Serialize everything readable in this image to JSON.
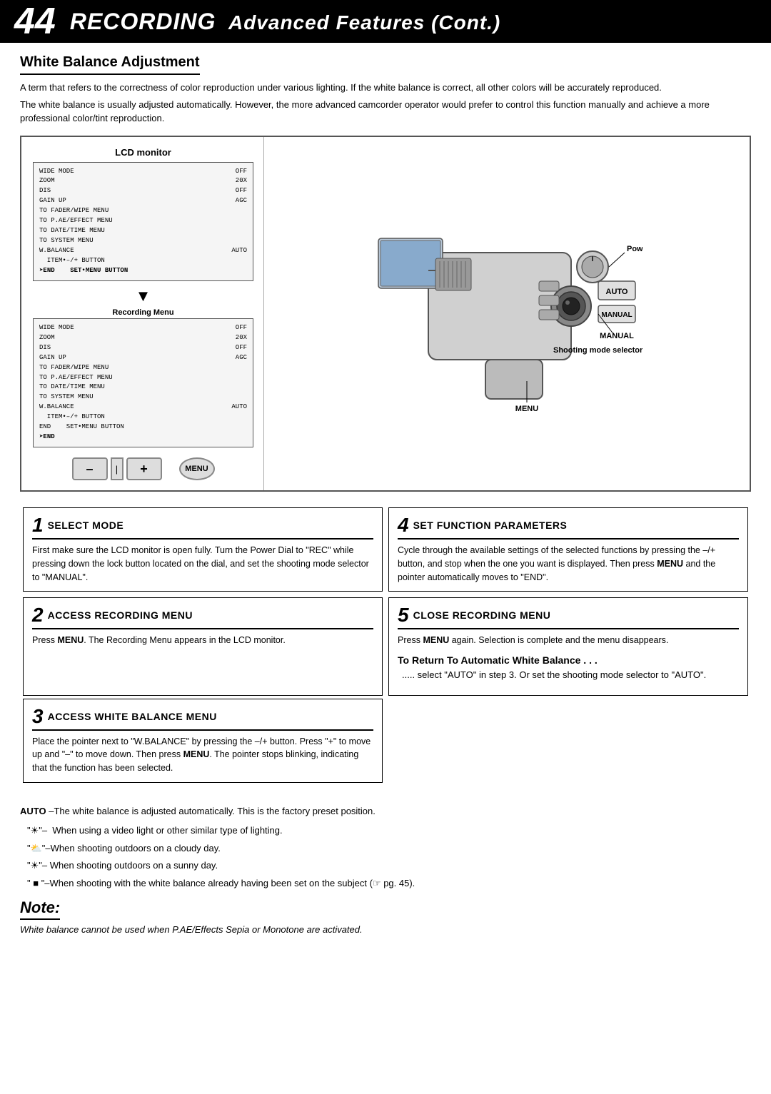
{
  "header": {
    "page_number": "44",
    "title_recording": "RECORDING",
    "title_rest": "Advanced Features (Cont.)"
  },
  "section": {
    "title": "White Balance Adjustment",
    "intro1": "A term that refers to the correctness of color reproduction under various lighting. If the white balance is correct, all other colors will be accurately reproduced.",
    "intro2": "The white balance is usually adjusted automatically. However, the more advanced camcorder operator would prefer to control this function manually and achieve a more professional color/tint reproduction."
  },
  "diagram": {
    "lcd_label": "LCD monitor",
    "menu_label": "Recording Menu",
    "power_dial_label": "Power Dial",
    "shooting_mode_label": "Shooting mode selector",
    "menu_button_label": "MENU",
    "manual_label": "MANUAL",
    "auto_label": "AUTO",
    "menu1_rows": [
      {
        "left": "WIDE MODE",
        "right": "OFF"
      },
      {
        "left": "ZOOM",
        "right": "20X"
      },
      {
        "left": "DIS",
        "right": "OFF"
      },
      {
        "left": "GAIN UP",
        "right": "AGC"
      },
      {
        "left": "TO FADER/WIPE MENU",
        "right": ""
      },
      {
        "left": "TO P.AE/EFFECT MENU",
        "right": ""
      },
      {
        "left": "TO DATE/TIME MENU",
        "right": ""
      },
      {
        "left": "TO SYSTEM MENU",
        "right": ""
      },
      {
        "left": "W.BALANCE",
        "right": "AUTO"
      },
      {
        "left": "  ITEM+–/+ BUTTON",
        "right": ""
      },
      {
        "left": "➤END   SET+MENU BUTTON",
        "right": ""
      }
    ],
    "menu2_rows": [
      {
        "left": "WIDE MODE",
        "right": "OFF"
      },
      {
        "left": "ZOOM",
        "right": "20X"
      },
      {
        "left": "DIS",
        "right": "OFF"
      },
      {
        "left": "GAIN UP",
        "right": "AGC"
      },
      {
        "left": "TO FADER/WIPE MENU",
        "right": ""
      },
      {
        "left": "TO P.AE/EFFECT MENU",
        "right": ""
      },
      {
        "left": "TO DATE/TIME MENU",
        "right": ""
      },
      {
        "left": "TO SYSTEM MENU",
        "right": ""
      },
      {
        "left": "W.BALANCE",
        "right": "AUTO"
      },
      {
        "left": "  ITEM+–/+ BUTTON",
        "right": ""
      },
      {
        "left": "END   SET+MENU BUTTON",
        "right": ""
      },
      {
        "left": "➤END",
        "right": ""
      }
    ],
    "btn_minus": "–",
    "btn_pipe": "|",
    "btn_plus": "+"
  },
  "steps": [
    {
      "num": "1",
      "title": "SELECT MODE",
      "body": "First make sure the LCD monitor is open fully. Turn the Power Dial to \"REC\" while pressing down the lock button located on the dial, and set the shooting mode selector to \"MANUAL\"."
    },
    {
      "num": "2",
      "title": "ACCESS RECORDING MENU",
      "body_prefix": "Press ",
      "body_bold": "MENU",
      "body_suffix": ". The Recording Menu appears in the LCD monitor."
    },
    {
      "num": "3",
      "title": "ACCESS WHITE BALANCE MENU",
      "body": "Place the pointer next to \"W.BALANCE\" by pressing the –/+ button. Press \"+\" to move up and \"–\" to move down. Then press MENU. The pointer stops blinking, indicating that the function has been selected."
    },
    {
      "num": "4",
      "title": "SET FUNCTION PARAMETERS",
      "body": "Cycle through the available settings of the selected functions by pressing the –/+ button, and stop when the one you want is displayed. Then press MENU and the pointer automatically moves to \"END\"."
    },
    {
      "num": "5",
      "title": "CLOSE RECORDING MENU",
      "body_prefix": "Press ",
      "body_bold": "MENU",
      "body_suffix": " again. Selection is complete and the menu disappears."
    }
  ],
  "auto_note": {
    "bold": "AUTO",
    "text": "–The white balance is adjusted automatically. This is the factory preset position."
  },
  "bullets": [
    "\"☀\"–  When using a video light or other similar type of lighting.",
    "\"☁\"–When shooting outdoors on a cloudy day.",
    "\"☀\"– When shooting outdoors on a sunny day.",
    "\" ⬛ \"–When shooting with the white balance already having been set on the subject (☞ pg. 45)."
  ],
  "to_return": {
    "heading": "To Return To Automatic White Balance . . .",
    "body": "..... select \"AUTO\" in step 3. Or set the shooting mode selector to \"AUTO\"."
  },
  "note": {
    "title": "NOTE:",
    "body": "White balance cannot be used when P.AE/Effects Sepia or Monotone are activated."
  }
}
